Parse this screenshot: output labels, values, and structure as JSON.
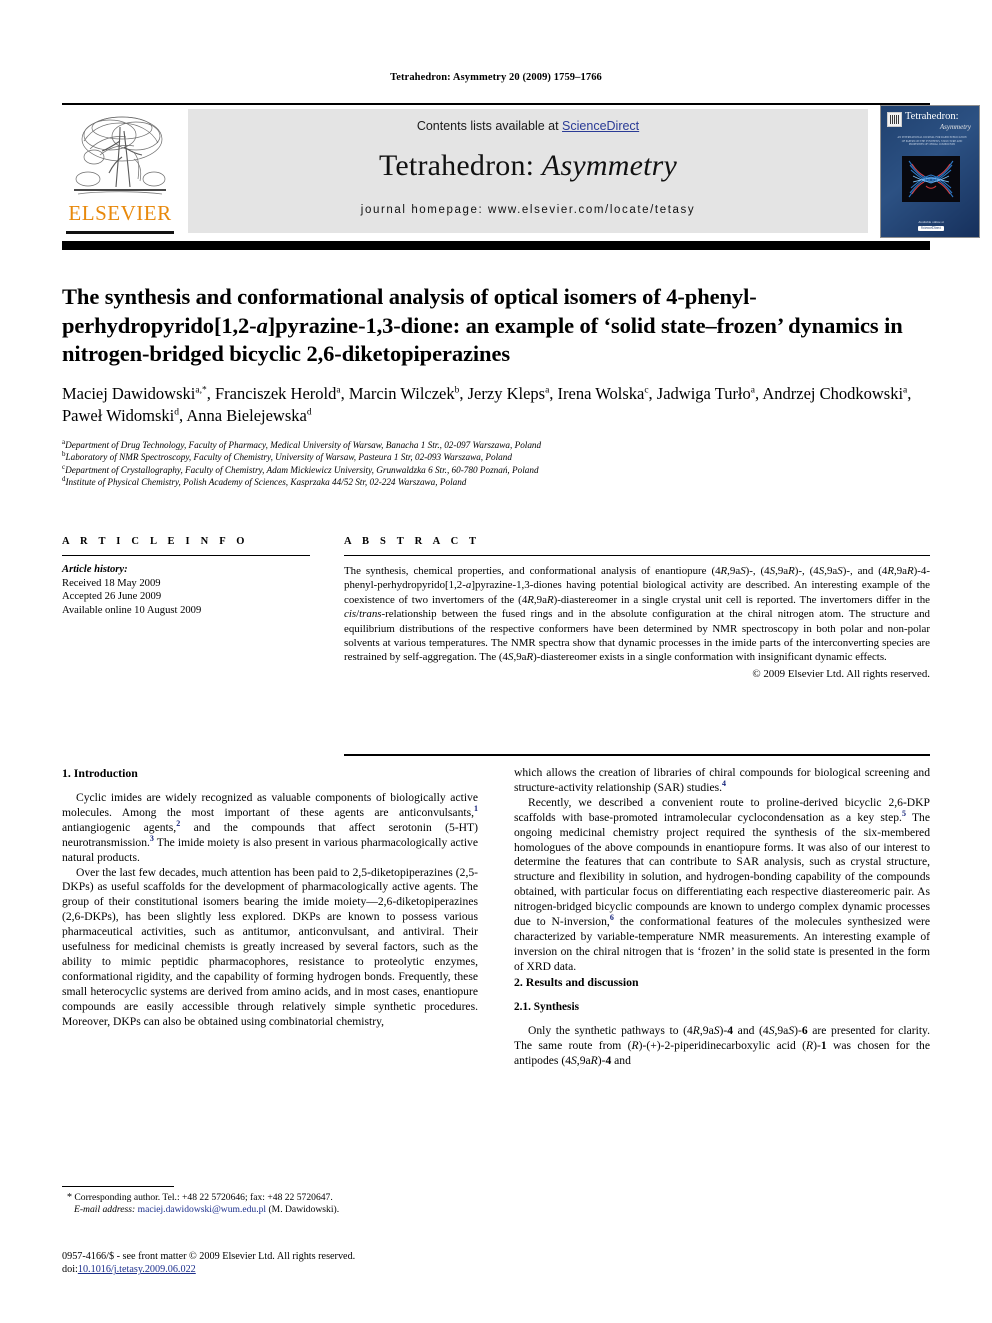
{
  "running_head": "Tetrahedron: Asymmetry 20 (2009) 1759–1766",
  "masthead": {
    "contents_prefix": "Contents lists available at ",
    "sciencedirect": "ScienceDirect",
    "journal_title_main": "Tetrahedron: ",
    "journal_title_italic": "Asymmetry",
    "homepage": "journal homepage: www.elsevier.com/locate/tetasy",
    "publisher_wordmark": "ELSEVIER",
    "publisher_color": "#E8890C",
    "link_color": "#2a3b96",
    "band_color": "#e4e4e4"
  },
  "cover": {
    "title_main": "Tetrahedron:",
    "title_sub": "Asymmetry",
    "blurb": "AN INTERNATIONAL JOURNAL FOR RAPID PUBLICATION OF PAPERS ON THE SYNTHESIS, STRUCTURE AND PROPERTIES OF CHIRAL COMPOUNDS",
    "footer_line": "Available online at",
    "footer_badge": "ScienceDirect",
    "bg_color": "#1d3b6e"
  },
  "article": {
    "title_part1": "The synthesis and conformational analysis of optical isomers of 4-phenyl-perhydropyrido[1,2-",
    "title_italic_a": "a",
    "title_part2": "]pyrazine-1,3-dione: an example of ‘solid state–frozen’ dynamics in nitrogen-bridged bicyclic 2,6-diketopiperazines",
    "authors_html": "Maciej Dawidowski, Franciszek Herold, Marcin Wilczek, Jerzy Kleps, Irena Wolska, Jadwiga Turło, Andrzej Chodkowski, Paweł Widomski, Anna Bielejewska",
    "author_list": [
      {
        "name": "Maciej Dawidowski",
        "marks": "a,*"
      },
      {
        "name": "Franciszek Herold",
        "marks": "a"
      },
      {
        "name": "Marcin Wilczek",
        "marks": "b"
      },
      {
        "name": "Jerzy Kleps",
        "marks": "a"
      },
      {
        "name": "Irena Wolska",
        "marks": "c"
      },
      {
        "name": "Jadwiga Turło",
        "marks": "a"
      },
      {
        "name": "Andrzej Chodkowski",
        "marks": "a"
      },
      {
        "name": "Paweł Widomski",
        "marks": "d"
      },
      {
        "name": "Anna Bielejewska",
        "marks": "d"
      }
    ],
    "affiliations": [
      {
        "mark": "a",
        "text": "Department of Drug Technology, Faculty of Pharmacy, Medical University of Warsaw, Banacha 1 Str., 02-097 Warszawa, Poland"
      },
      {
        "mark": "b",
        "text": "Laboratory of NMR Spectroscopy, Faculty of Chemistry, University of Warsaw, Pasteura 1 Str, 02-093 Warszawa, Poland"
      },
      {
        "mark": "c",
        "text": "Department of Crystallography, Faculty of Chemistry, Adam Mickiewicz University, Grunwaldzka 6 Str., 60-780 Poznań, Poland"
      },
      {
        "mark": "d",
        "text": "Institute of Physical Chemistry, Polish Academy of Sciences, Kasprzaka 44/52 Str, 02-224 Warszawa, Poland"
      }
    ]
  },
  "article_info": {
    "heading": "A R T I C L E   I N F O",
    "history_label": "Article history:",
    "received": "Received 18 May 2009",
    "accepted": "Accepted 26 June 2009",
    "available": "Available online 10 August 2009"
  },
  "abstract": {
    "heading": "A B S T R A C T",
    "copyright": "© 2009 Elsevier Ltd. All rights reserved."
  },
  "sections": {
    "introduction_heading": "1. Introduction",
    "results_heading": "2. Results and discussion",
    "synthesis_heading": "2.1. Synthesis"
  },
  "footnote": {
    "star": "*",
    "corresponding": "Corresponding author. Tel.: +48 22 5720646; fax: +48 22 5720647.",
    "email_label": "E-mail address:",
    "email": "maciej.dawidowski@wum.edu.pl",
    "email_owner": "(M. Dawidowski)."
  },
  "imprint": {
    "line1": "0957-4166/$ - see front matter © 2009 Elsevier Ltd. All rights reserved.",
    "doi_label": "doi:",
    "doi": "10.1016/j.tetasy.2009.06.022"
  }
}
